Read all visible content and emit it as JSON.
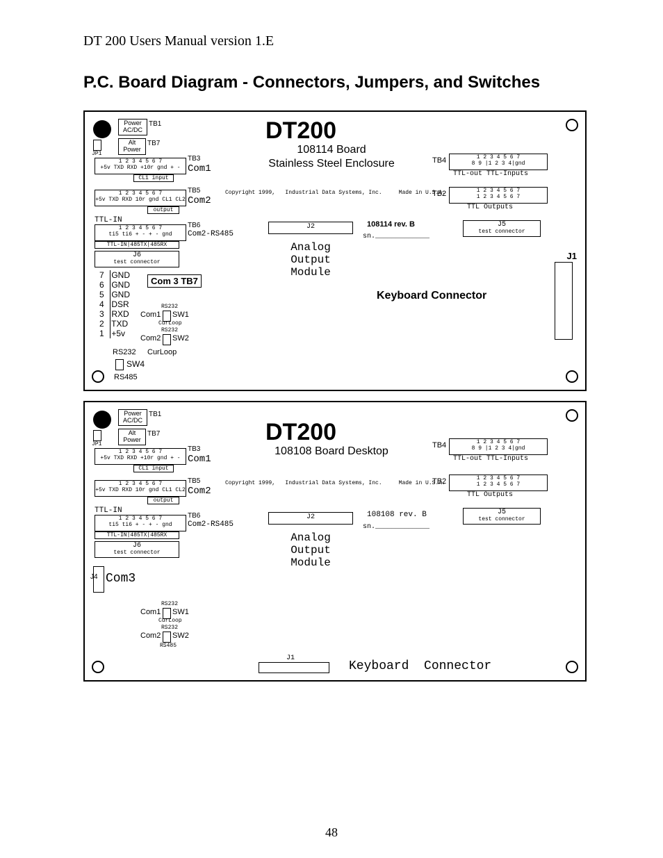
{
  "header": "DT 200 Users Manual version 1.E",
  "title": "P.C. Board Diagram - Connectors, Jumpers, and Switches",
  "page_number": "48",
  "common": {
    "product": "DT200",
    "copyright": "Copyright 1999,   Industrial Data Systems, Inc.     Made in U.S.A.",
    "analog": "Analog\nOutput\nModule",
    "sn": "sn._____________",
    "tb1": "TB1",
    "tb1_lbl": "Power\nAC/DC",
    "tb7": "TB7",
    "tb7_lbl": "Alt\nPower",
    "jp1": "JP1",
    "tb3": "TB3",
    "com1": "Com1",
    "cl1in": "CL1 input",
    "tb5": "TB5",
    "com2": "Com2",
    "output": "output",
    "tb6": "TB6",
    "com2rs": "Com2-RS485",
    "ttlin": "TTL-IN",
    "ttlrow": "TTL-IN|485TX|485RX",
    "j6": "J6",
    "j6_lbl": "test connector",
    "j5": "J5",
    "j5_lbl": "test connector",
    "j2": "J2",
    "tb4": "TB4",
    "tb4_sub": "TTL-out TTL-Inputs",
    "tb2": "TB2",
    "tb2_sub": "TTL Outputs",
    "pinrow1": "1  2  3  4  5  6  7",
    "pinrow2": "1  2  3  4  5  6  7",
    "tb3pins": "+5v TXD RXD +10r gnd  +   -",
    "tb5pins": "+5v TXD RXD 10r gnd CL1 CL2",
    "tb6pins": "ti5 ti6  +   -   +   -  gnd",
    "tb4pins_top": "1  2  3  4  5  6  7",
    "tb4pins_bot": "8  9  |1  2  3  4|gnd",
    "tb2pins_top": "1  2  3  4  5  6  7",
    "tb2pins_bot": "1  2  3  4  5  6  7",
    "sw_rs232a": "RS232",
    "sw_curloop": "CurLoop",
    "sw_rs485": "RS485",
    "sw1": "SW1",
    "sw2": "SW2",
    "sw4": "SW4",
    "com1lbl": "Com1",
    "com2lbl": "Com2",
    "kb": "Keyboard Connector"
  },
  "board1": {
    "subtitle1": "108114 Board",
    "subtitle2": "Stainless Steel Enclosure",
    "rev": "108114 rev. B",
    "com3": "Com 3 TB7",
    "j1": "J1",
    "pins": [
      {
        "n": "7",
        "s": "GND"
      },
      {
        "n": "6",
        "s": "GND"
      },
      {
        "n": "5",
        "s": "GND"
      },
      {
        "n": "4",
        "s": "DSR"
      },
      {
        "n": "3",
        "s": "RXD"
      },
      {
        "n": "2",
        "s": "TXD"
      },
      {
        "n": "1",
        "s": "+5v"
      }
    ],
    "rs232": "RS232",
    "curloop": "CurLoop"
  },
  "board2": {
    "subtitle": "108108 Board Desktop",
    "rev": "108108 rev. B",
    "com3": "Com3",
    "j4": "J4",
    "j1": "J1",
    "kb2": "Keyboard  Connector"
  }
}
